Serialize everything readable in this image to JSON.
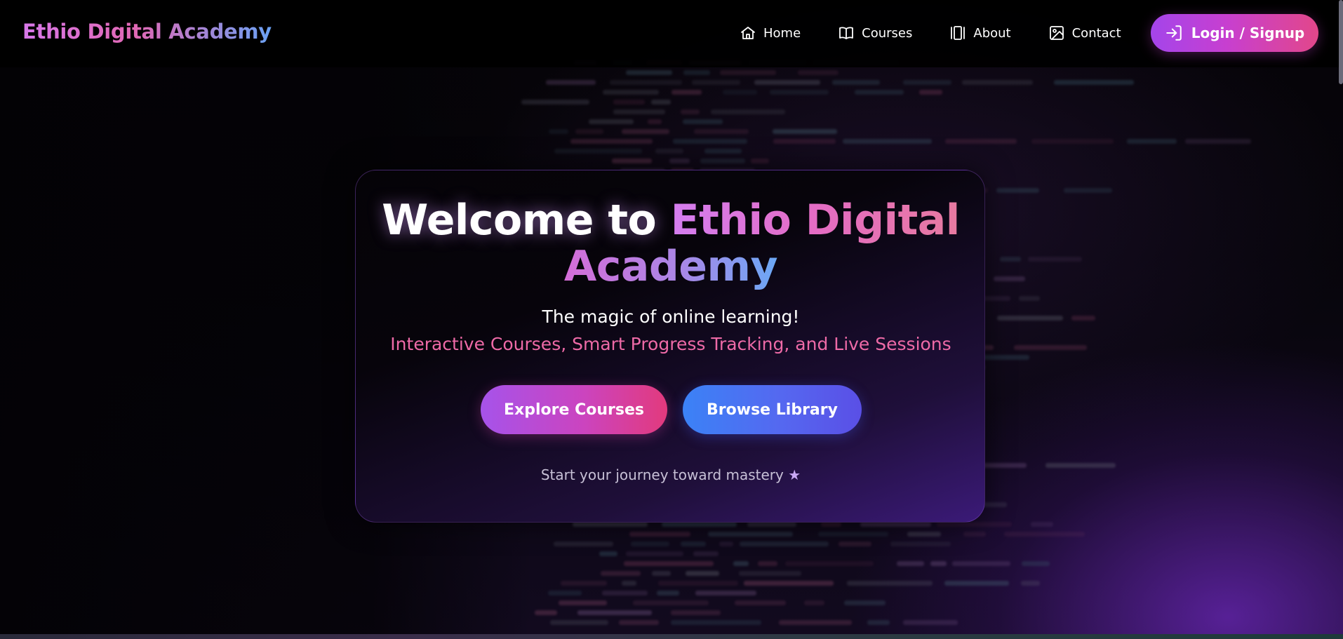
{
  "header": {
    "brand": "Ethio Digital Academy",
    "nav": [
      {
        "label": "Home",
        "icon": "home-icon"
      },
      {
        "label": "Courses",
        "icon": "book-icon"
      },
      {
        "label": "About",
        "icon": "panel-icon"
      },
      {
        "label": "Contact",
        "icon": "image-icon"
      }
    ],
    "login_label": "Login / Signup",
    "login_icon": "login-icon"
  },
  "hero": {
    "title_prefix": "Welcome to ",
    "title_accent_1": "Ethio Digital",
    "title_accent_2": "Academy",
    "subtitle": "The magic of online learning!",
    "features": "Interactive Courses, Smart Progress Tracking, and Live Sessions",
    "explore_label": "Explore Courses",
    "library_label": "Browse Library",
    "tagline": "Start your journey toward mastery",
    "tagline_icon": "★"
  },
  "colors": {
    "brand_gradient_start": "#d878ea",
    "brand_gradient_end": "#6aa2f5",
    "accent_pink": "#ee6aa7",
    "primary_purple": "#a653ea",
    "primary_blue": "#3b82f6",
    "background": "#050307"
  }
}
